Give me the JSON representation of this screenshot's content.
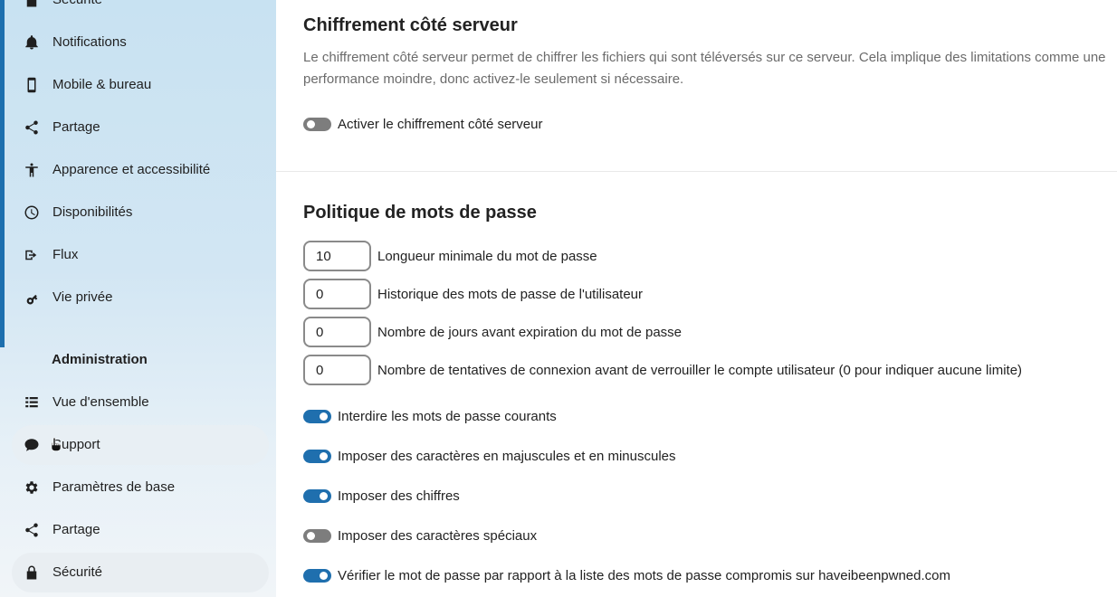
{
  "sidebar": {
    "items_top": [
      {
        "label": "Sécurité",
        "icon": "lock-icon"
      },
      {
        "label": "Notifications",
        "icon": "bell-icon"
      },
      {
        "label": "Mobile & bureau",
        "icon": "mobile-icon"
      },
      {
        "label": "Partage",
        "icon": "share-icon"
      },
      {
        "label": "Apparence et accessibilité",
        "icon": "accessibility-icon"
      },
      {
        "label": "Disponibilités",
        "icon": "clock-icon"
      },
      {
        "label": "Flux",
        "icon": "flow-icon"
      },
      {
        "label": "Vie privée",
        "icon": "key-icon"
      }
    ],
    "admin_heading": "Administration",
    "items_admin": [
      {
        "label": "Vue d'ensemble",
        "icon": "list-icon"
      },
      {
        "label": "Support",
        "icon": "chat-icon"
      },
      {
        "label": "Paramètres de base",
        "icon": "gear-icon"
      },
      {
        "label": "Partage",
        "icon": "share-icon"
      },
      {
        "label": "Sécurité",
        "icon": "lock-icon"
      }
    ],
    "accent_color": "#1d6fae"
  },
  "encryption": {
    "title": "Chiffrement côté serveur",
    "description": "Le chiffrement côté serveur permet de chiffrer les fichiers qui sont téléversés sur ce serveur. Cela implique des limitations comme une performance moindre, donc activez-le seulement si nécessaire.",
    "toggle_label": "Activer le chiffrement côté serveur",
    "toggle_on": false
  },
  "password_policy": {
    "title": "Politique de mots de passe",
    "fields": [
      {
        "value": "10",
        "label": "Longueur minimale du mot de passe"
      },
      {
        "value": "0",
        "label": "Historique des mots de passe de l'utilisateur"
      },
      {
        "value": "0",
        "label": "Nombre de jours avant expiration du mot de passe"
      },
      {
        "value": "0",
        "label": "Nombre de tentatives de connexion avant de verrouiller le compte utilisateur (0 pour indiquer aucune limite)"
      }
    ],
    "toggles": [
      {
        "label": "Interdire les mots de passe courants",
        "on": true
      },
      {
        "label": "Imposer des caractères en majuscules et en minuscules",
        "on": true
      },
      {
        "label": "Imposer des chiffres",
        "on": true
      },
      {
        "label": "Imposer des caractères spéciaux",
        "on": false
      },
      {
        "label": "Vérifier le mot de passe par rapport à la liste des mots de passe compromis sur haveibeenpwned.com",
        "on": true
      }
    ]
  },
  "colors": {
    "toggle_on": "#1f6fae",
    "toggle_off": "#7d7d7d"
  }
}
